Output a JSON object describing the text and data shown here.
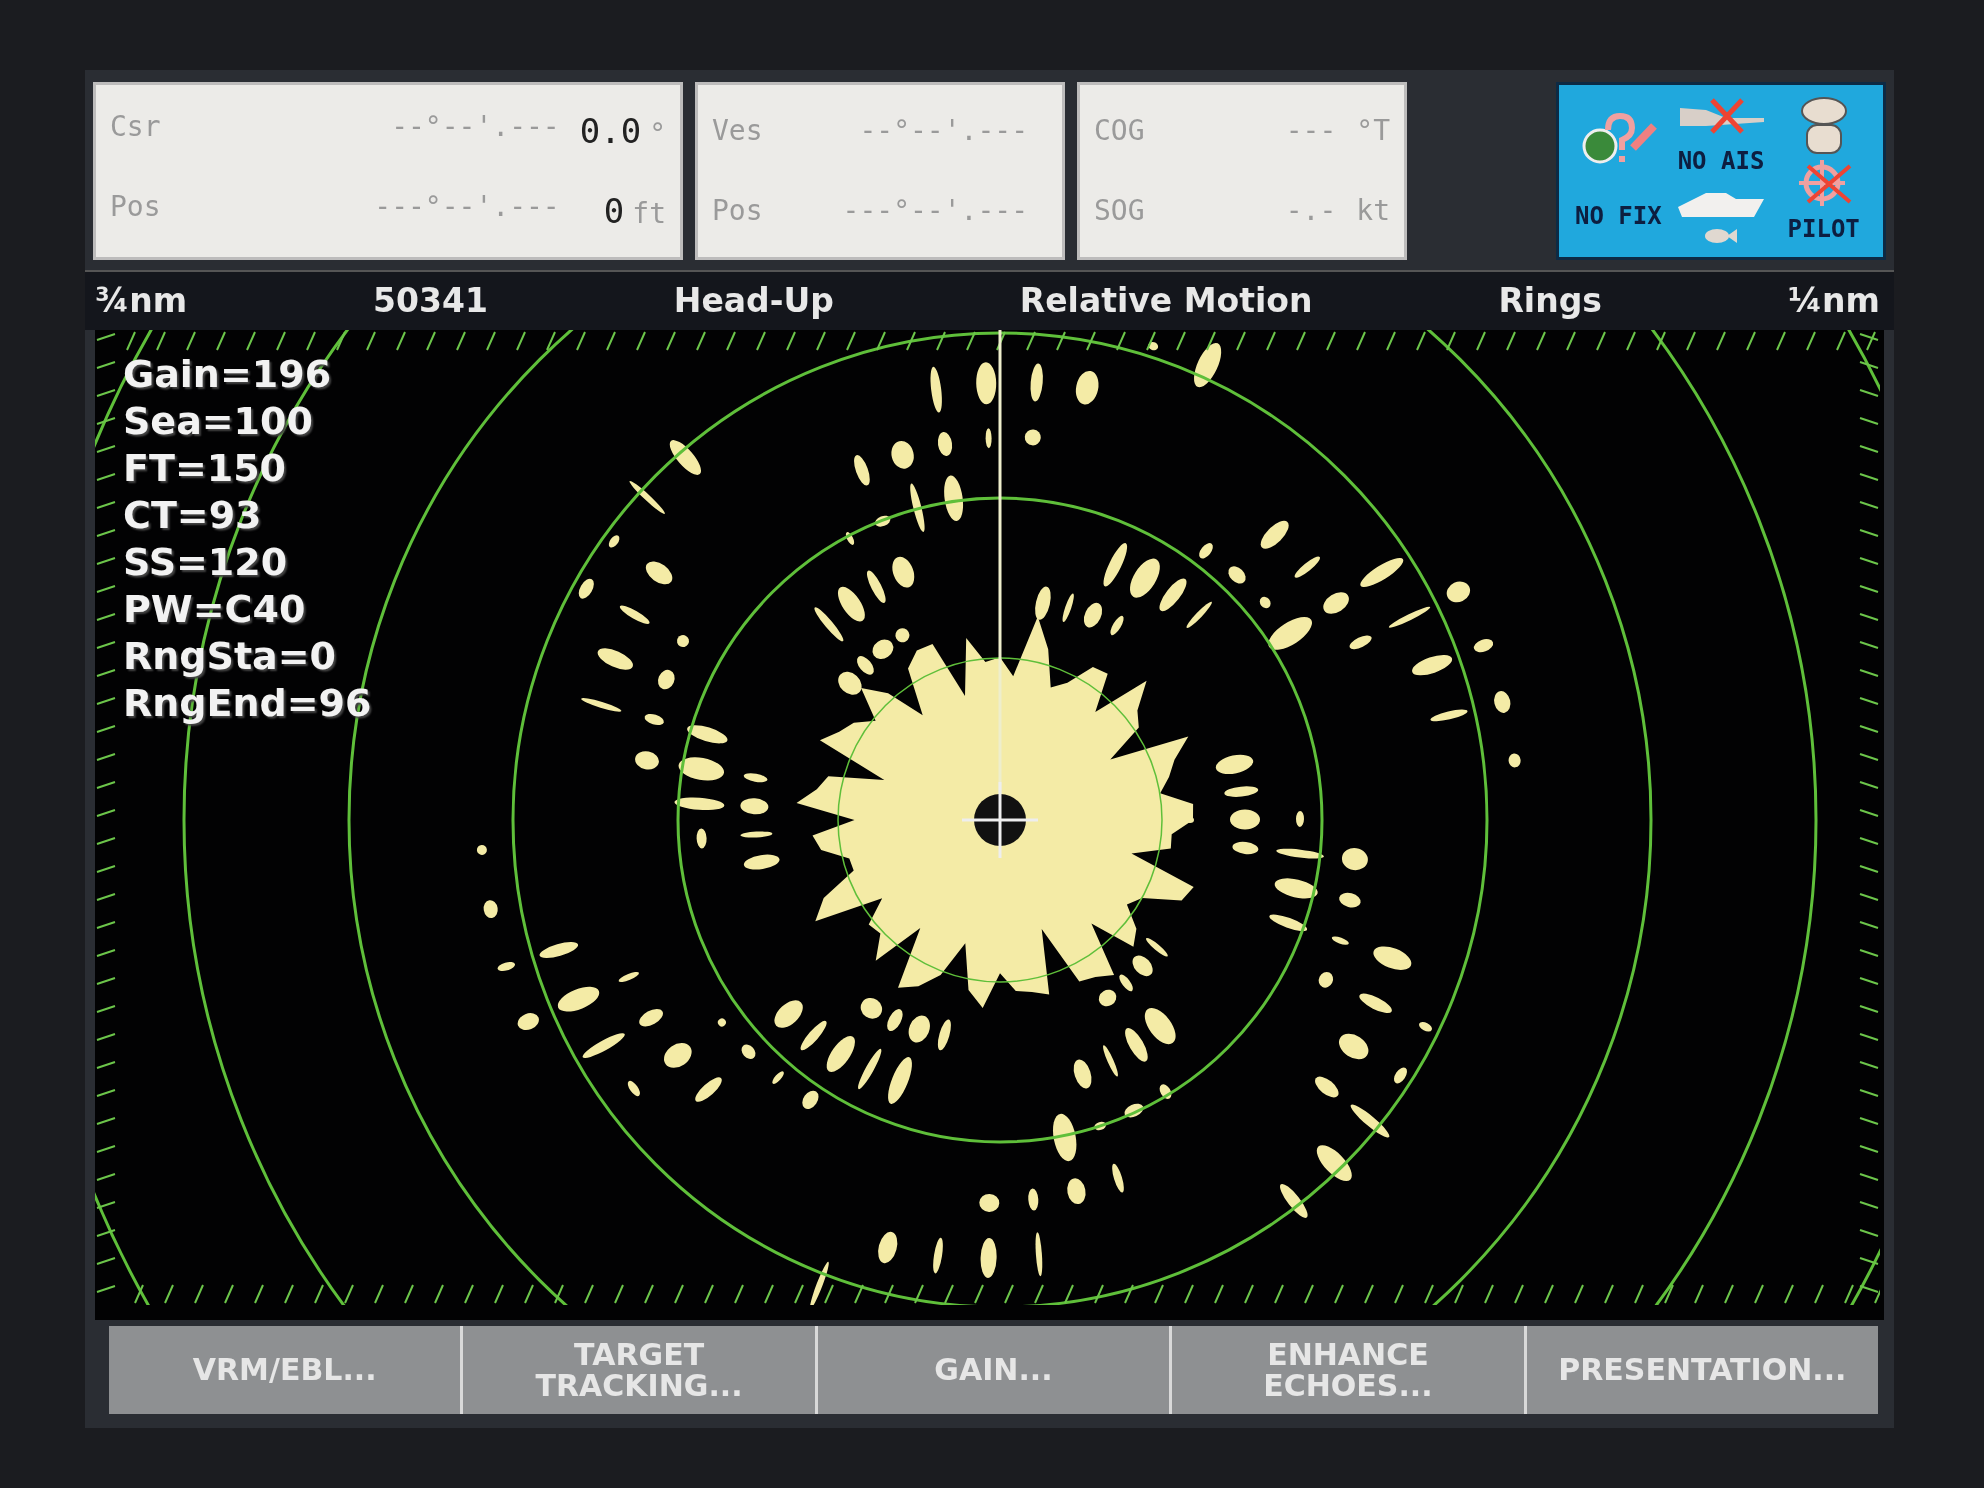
{
  "data_boxes": [
    {
      "rows": [
        {
          "label": "Csr",
          "value": "--°--'.---",
          "reading": "0.0",
          "unit": "°"
        },
        {
          "label": "Pos",
          "value": "---°--'.---",
          "reading": "0",
          "unit": "ft"
        }
      ]
    },
    {
      "rows": [
        {
          "label": "Ves",
          "value": "--°--'.---"
        },
        {
          "label": "Pos",
          "value": "---°--'.---"
        }
      ]
    },
    {
      "rows": [
        {
          "label": "COG",
          "value": "---",
          "unit": "°T"
        },
        {
          "label": "SOG",
          "value": "-.-",
          "unit": "kt"
        }
      ]
    }
  ],
  "status_icons": {
    "fix": "NO FIX",
    "ais": "NO AIS",
    "pilot": "PILOT"
  },
  "status_bar": [
    "¾nm",
    "50341",
    "Head-Up",
    "Relative Motion",
    "Rings",
    "¼nm"
  ],
  "settings": [
    "Gain=196",
    "Sea=100",
    "FT=150",
    "CT=93",
    "SS=120",
    "PW=C40",
    "RngSta=0",
    "RngEnd=96"
  ],
  "softkeys": [
    {
      "lines": [
        "VRM/EBL..."
      ]
    },
    {
      "lines": [
        "TARGET",
        "TRACKING..."
      ]
    },
    {
      "lines": [
        "GAIN..."
      ]
    },
    {
      "lines": [
        "ENHANCE",
        "ECHOES..."
      ]
    },
    {
      "lines": [
        "PRESENTATION..."
      ]
    }
  ]
}
